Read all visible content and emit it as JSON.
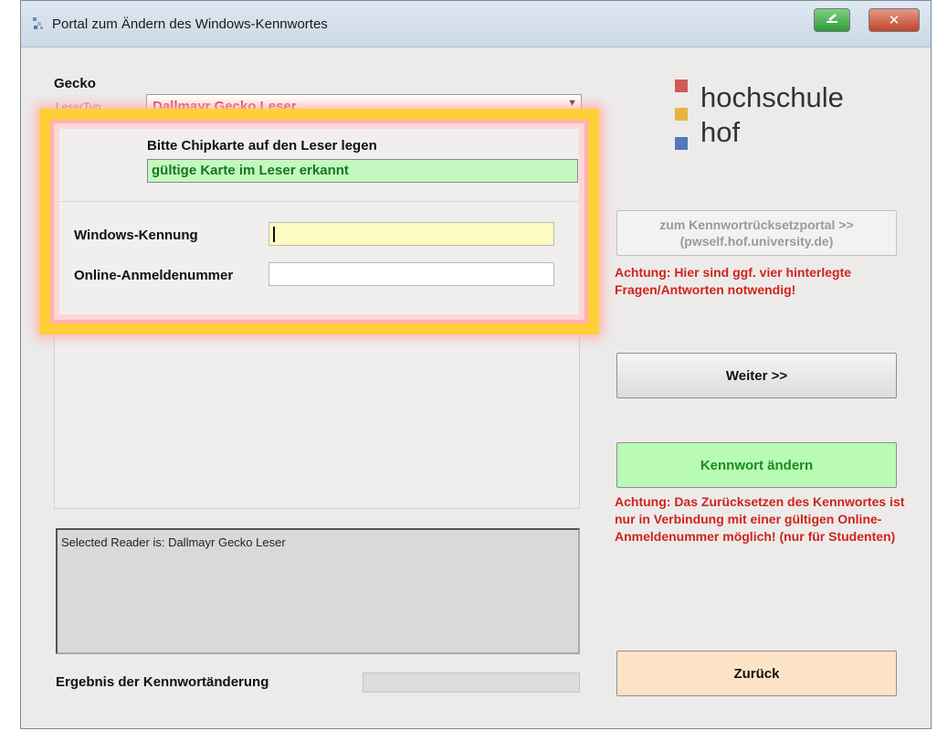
{
  "window": {
    "title": "Portal zum Ändern des Windows-Kennwortes"
  },
  "form": {
    "gecko_label": "Gecko",
    "lesertyp_label": "LeserTyp",
    "lesertyp_value": "Dallmayr Gecko Leser",
    "chip_prompt": "Bitte Chipkarte auf den Leser legen",
    "chip_status": "gültige Karte im Leser erkannt",
    "kennung_label": "Windows-Kennung",
    "kennung_value": "",
    "anmelde_label": "Online-Anmeldenummer",
    "anmelde_value": ""
  },
  "log": {
    "text": "Selected Reader is: Dallmayr Gecko Leser"
  },
  "result": {
    "label": "Ergebnis der Kennwortänderung"
  },
  "logo": {
    "line1": "hochschule",
    "line2": "hof"
  },
  "actions": {
    "portal_line1": "zum Kennwortrücksetzportal >>",
    "portal_line2": "(pwself.hof.university.de)",
    "warning1": "Achtung: Hier sind ggf. vier hinterlegte Fragen/Antworten notwendig!",
    "weiter_label": "Weiter >>",
    "kennwort_label": "Kennwort ändern",
    "warning2": "Achtung: Das Zurücksetzen des Kennwortes ist nur in Verbindung mit einer gültigen Online-Anmeldenummer möglich! (nur für Studenten)",
    "zurueck_label": "Zurück"
  },
  "colors": {
    "highlight_frame": "#ffcf36",
    "status_green": "#c5f7c0",
    "warning_red": "#d1231c",
    "logo_red": "#d05a55",
    "logo_yellow": "#e9b43e",
    "logo_blue": "#5676b8"
  },
  "icons": {
    "app": "app-icon",
    "minimize": "minimize-icon",
    "close": "close-icon"
  }
}
